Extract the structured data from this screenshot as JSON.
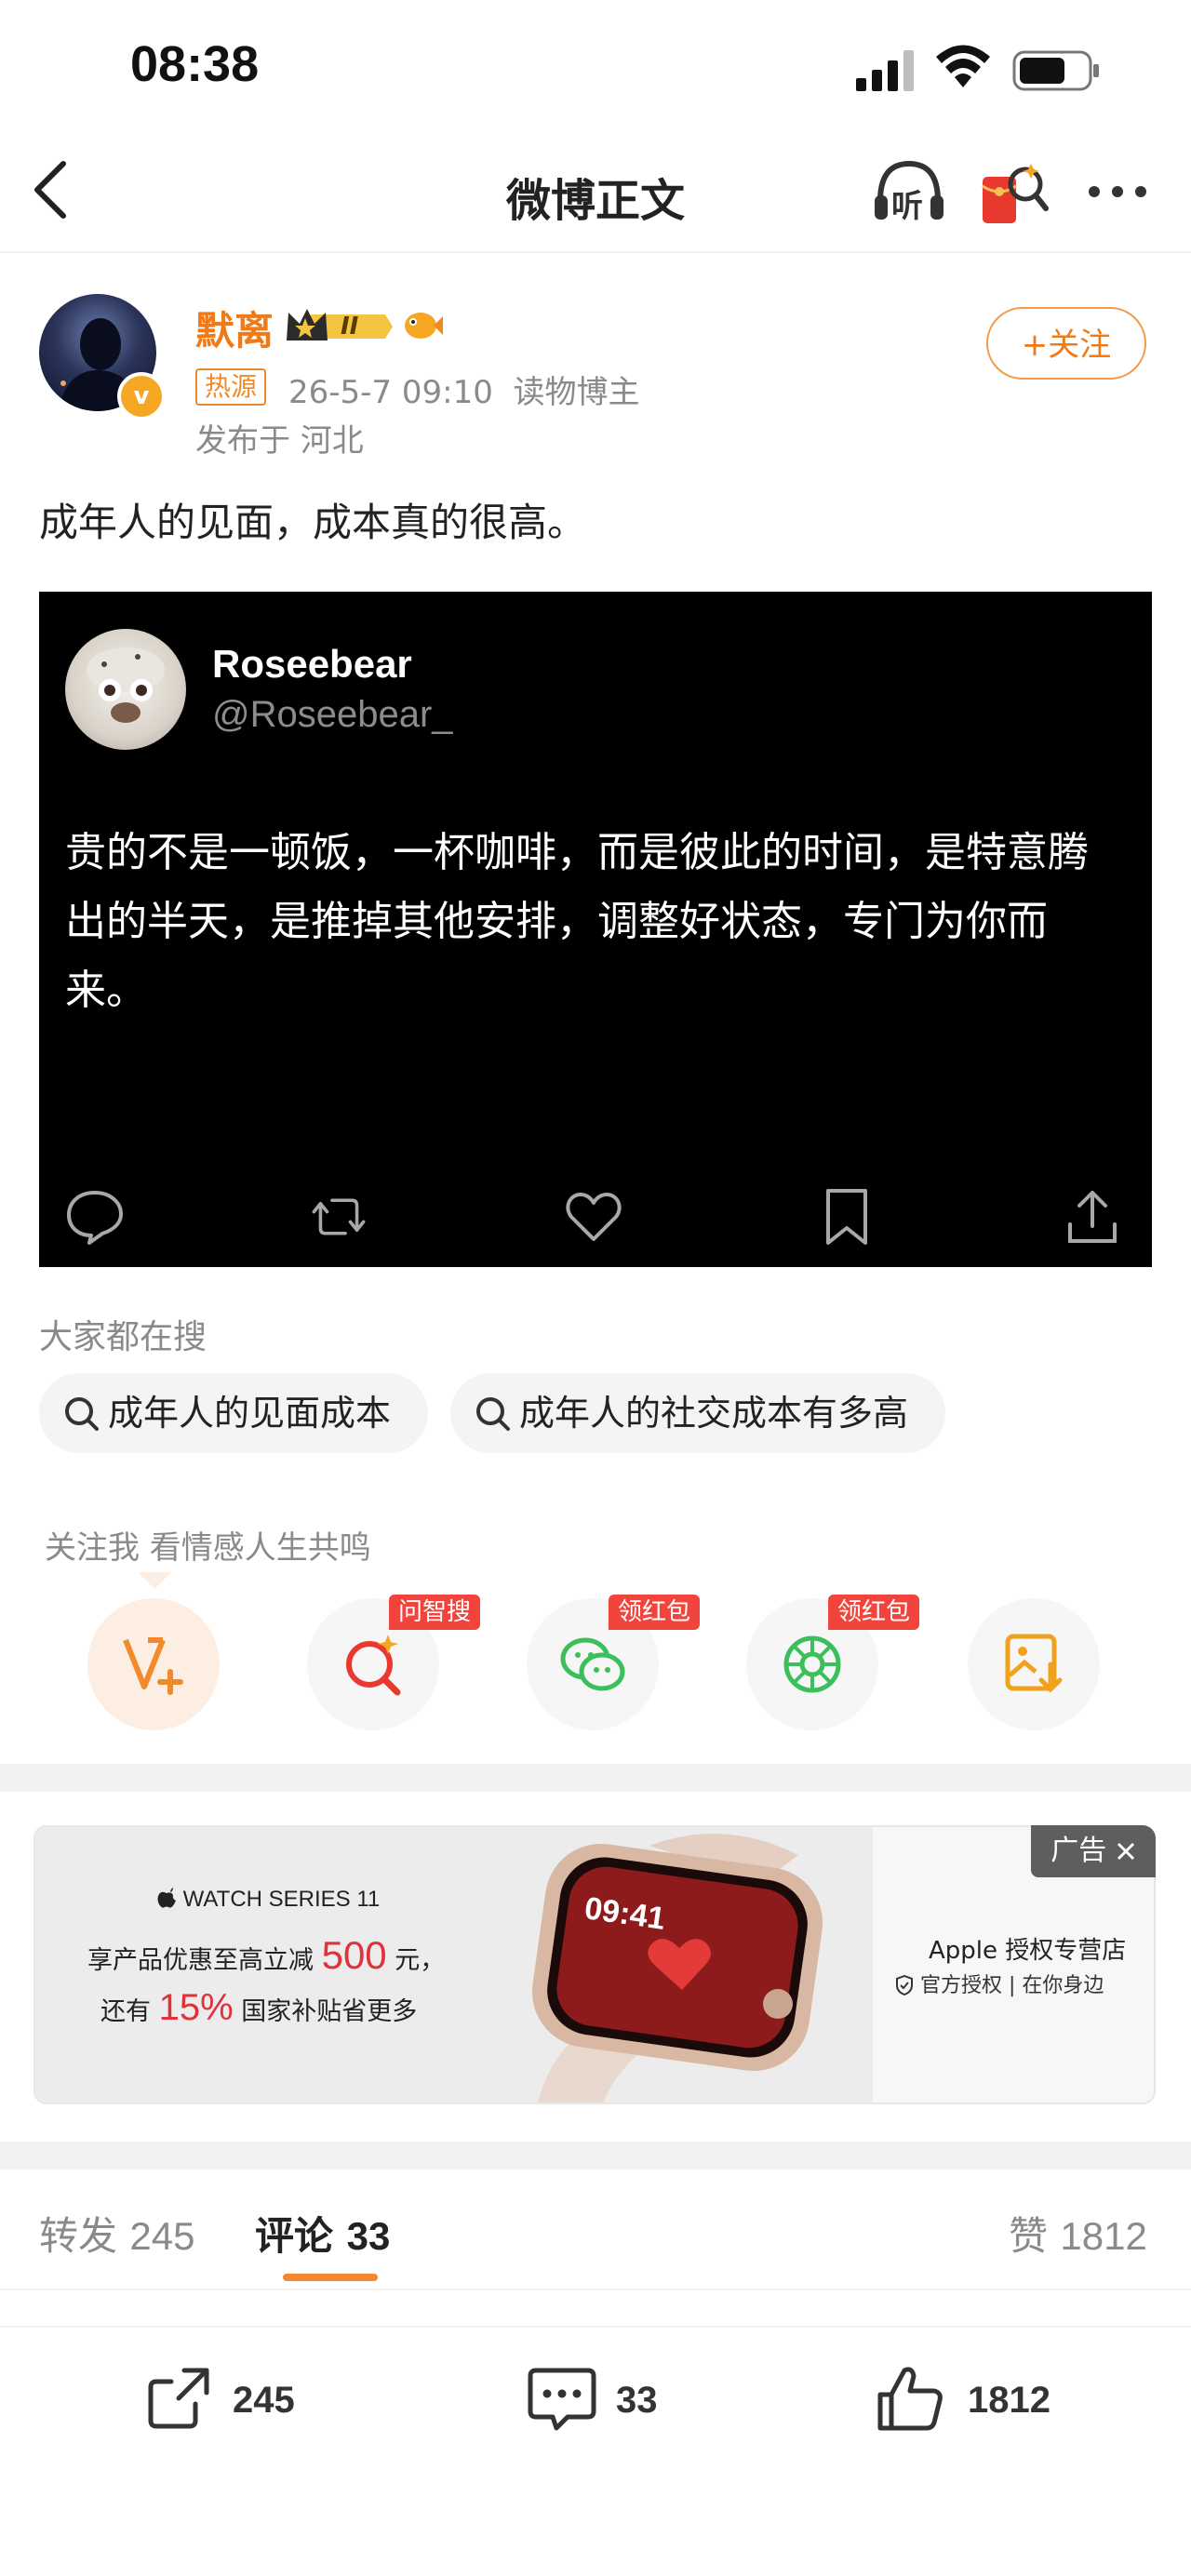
{
  "status_bar": {
    "time": "08:38"
  },
  "nav": {
    "title": "微博正文",
    "listen_label": "听"
  },
  "author": {
    "name": "默离",
    "level_badge": "II",
    "verify_mark": "v",
    "hot_tag": "热源",
    "meta": "26-5-7 09:10  读物博主",
    "location": "发布于 河北",
    "follow_label": "+关注"
  },
  "post": {
    "text": "成年人的见面，成本真的很高。"
  },
  "embedded_card": {
    "name": "Roseebear",
    "handle": "@Roseebear_",
    "text": "贵的不是一顿饭，一杯咖啡，而是彼此的时间，是特意腾出的半天，是推掉其他安排，调整好状态，专门为你而来。"
  },
  "search": {
    "heading": "大家都在搜",
    "chips": [
      "成年人的见面成本",
      "成年人的社交成本有多高"
    ]
  },
  "follow_tip": "关注我 看情感人生共鸣",
  "tools": [
    {
      "icon": "vip-plus-icon",
      "badge": ""
    },
    {
      "icon": "ai-search-icon",
      "badge": "问智搜"
    },
    {
      "icon": "wechat-icon",
      "badge": "领红包"
    },
    {
      "icon": "moments-icon",
      "badge": "领红包"
    },
    {
      "icon": "save-image-icon",
      "badge": ""
    }
  ],
  "ad": {
    "tag": "广告",
    "brand": "WATCH SERIES 11",
    "line1_prefix": "享产品优惠至高立减",
    "line1_value": "500",
    "line1_suffix": "元，",
    "line2_prefix": "还有",
    "line2_value": "15%",
    "line2_suffix": "国家补贴省更多",
    "store": "Apple 授权专营店",
    "store_tags": "官方授权 | 在你身边",
    "watch_time": "09:41"
  },
  "tabs": {
    "repost": {
      "label": "转发",
      "count": "245"
    },
    "comment": {
      "label": "评论",
      "count": "33"
    },
    "like": {
      "label": "赞",
      "count": "1812"
    }
  },
  "actions": {
    "repost_count": "245",
    "comment_count": "33",
    "like_count": "1812"
  },
  "colors": {
    "brand_orange": "#ef7b18",
    "badge_red": "#f0443c",
    "ad_red": "#e0323c"
  }
}
